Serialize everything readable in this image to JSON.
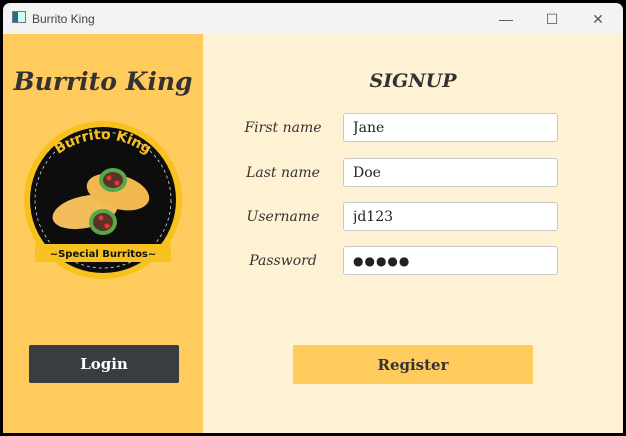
{
  "window": {
    "title": "Burrito King",
    "minimize": "—",
    "maximize": "☐",
    "close": "✕"
  },
  "sidebar": {
    "brand": "Burrito King",
    "logo_text_top": "Burrito King",
    "logo_text_bottom": "~Special Burritos~",
    "login_label": "Login"
  },
  "form": {
    "title": "SIGNUP",
    "fields": [
      {
        "label": "First name",
        "value": "Jane"
      },
      {
        "label": "Last name",
        "value": "Doe"
      },
      {
        "label": "Username",
        "value": "jd123"
      },
      {
        "label": "Password",
        "value": "●●●●●"
      }
    ],
    "register_label": "Register"
  },
  "colors": {
    "accent": "#ffcb5c",
    "panel": "#fff2d4",
    "dark_button": "#393c40"
  }
}
